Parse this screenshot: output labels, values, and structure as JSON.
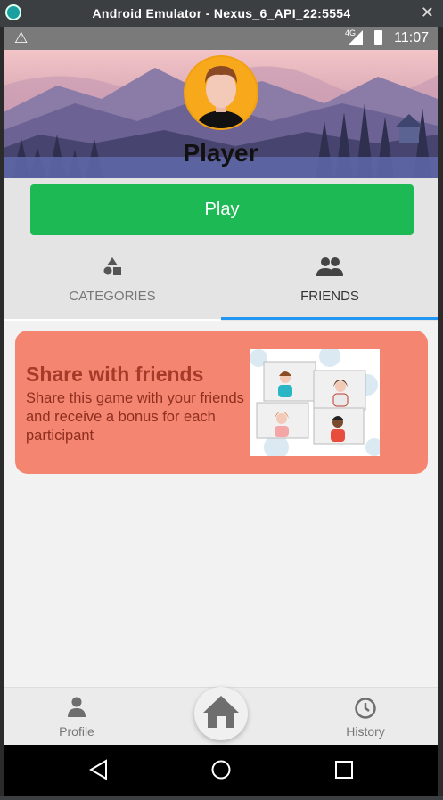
{
  "window": {
    "title": "Android Emulator - Nexus_6_API_22:5554",
    "close_label": "✕"
  },
  "status_bar": {
    "warning_icon": "warning-icon",
    "network": "4G",
    "time": "11:07"
  },
  "header": {
    "player_name": "Player"
  },
  "play_button": {
    "label": "Play",
    "color": "#1db954"
  },
  "tabs": [
    {
      "label": "CATEGORIES",
      "icon": "shapes-icon",
      "selected": false
    },
    {
      "label": "FRIENDS",
      "icon": "people-icon",
      "selected": true
    }
  ],
  "share_card": {
    "title": "Share with friends",
    "description": "Share this game with your friends and receive a bonus for each participant",
    "color": "#f48570"
  },
  "bottom_nav": {
    "profile_label": "Profile",
    "history_label": "History",
    "home_icon": "home-icon"
  },
  "colors": {
    "accent": "#2196f3",
    "avatar_bg": "#f7a81b"
  }
}
